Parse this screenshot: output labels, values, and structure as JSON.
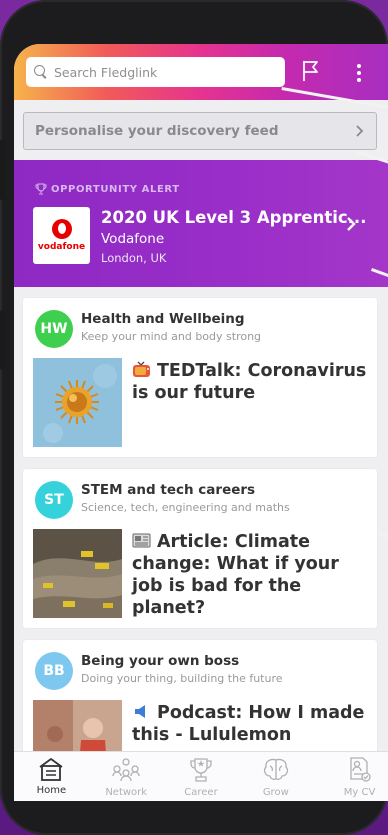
{
  "search": {
    "placeholder": "Search Fledglink"
  },
  "personalise": {
    "label": "Personalise your discovery feed"
  },
  "opportunity": {
    "tag": "OPPORTUNITY ALERT",
    "title": "2020 UK Level 3 Apprentic...",
    "company": "Vodafone",
    "location": "London, UK",
    "logo_text": "vodafone"
  },
  "cards": [
    {
      "initials": "HW",
      "avatar_color": "#3fcf4f",
      "title": "Health and Wellbeing",
      "subtitle": "Keep your mind and body strong",
      "post_icon": "tv-icon",
      "post_title": "TEDTalk: Coronavirus is our future"
    },
    {
      "initials": "ST",
      "avatar_color": "#35d2dc",
      "title": "STEM and tech careers",
      "subtitle": "Science, tech, engineering and maths",
      "post_icon": "newspaper-icon",
      "post_title": "Article: Climate change: What if your job is bad for the planet?"
    },
    {
      "initials": "BB",
      "avatar_color": "#7ec8f0",
      "title": "Being your own boss",
      "subtitle": "Doing your thing, building the future",
      "post_icon": "speaker-icon",
      "post_title": "Podcast: How I made this - Lululemon"
    }
  ],
  "tabs": [
    {
      "label": "Home",
      "icon": "home-icon",
      "active": true
    },
    {
      "label": "Network",
      "icon": "network-icon",
      "active": false
    },
    {
      "label": "Career",
      "icon": "trophy-icon",
      "active": false
    },
    {
      "label": "Grow",
      "icon": "brain-icon",
      "active": false
    },
    {
      "label": "My CV",
      "icon": "cv-icon",
      "active": false
    }
  ],
  "colors": {
    "alert_purple": "#9a2ec8",
    "vodafone_red": "#e60000",
    "tab_active": "#333333",
    "tab_inactive": "#b0b0b4"
  }
}
